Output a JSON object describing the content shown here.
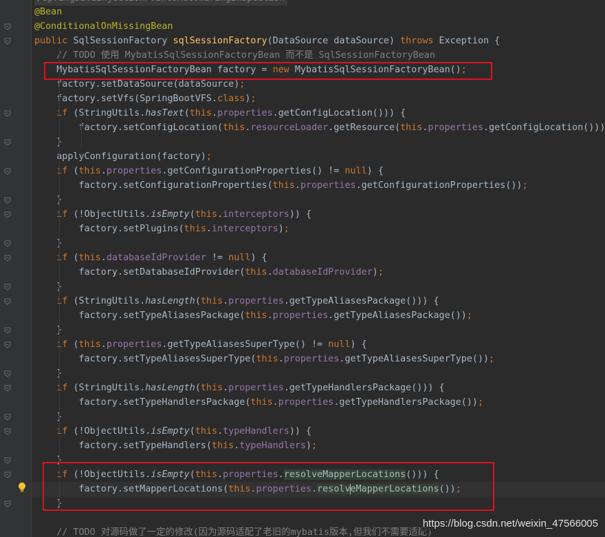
{
  "editor": {
    "top_partial": "/SpringJavaInjectionPointsAutowiringInspection",
    "lines": [
      [
        [
          "@Bean",
          "ann"
        ]
      ],
      [
        [
          "@ConditionalOnMissingBean",
          "ann"
        ]
      ],
      [
        [
          "public ",
          "kw"
        ],
        [
          "SqlSessionFactory ",
          "def"
        ],
        [
          "sqlSessionFactory",
          "fn"
        ],
        [
          "(DataSource dataSource) ",
          "def"
        ],
        [
          "throws ",
          "kw"
        ],
        [
          "Exception {",
          "def"
        ]
      ],
      [
        [
          "    // TODO 使用 MybatisSqlSessionFactoryBean 而不是 SqlSessionFactoryBean",
          "cm"
        ]
      ],
      [
        [
          "    MybatisSqlSessionFactoryBean factory = ",
          "def"
        ],
        [
          "new ",
          "kw"
        ],
        [
          "MybatisSqlSessionFactoryBean()",
          "def"
        ],
        [
          ";",
          "kw"
        ]
      ],
      [
        [
          "    factory.setDataSource(dataSource)",
          "def"
        ],
        [
          ";",
          "kw"
        ]
      ],
      [
        [
          "    factory.setVfs(SpringBootVFS.",
          "def"
        ],
        [
          "class",
          "kw"
        ],
        [
          ")",
          "def"
        ],
        [
          ";",
          "kw"
        ]
      ],
      [
        [
          "    ",
          "def"
        ],
        [
          "if ",
          "kw"
        ],
        [
          "(StringUtils.",
          "def"
        ],
        [
          "hasText",
          "it"
        ],
        [
          "(",
          "def"
        ],
        [
          "this",
          "kw"
        ],
        [
          ".",
          "def"
        ],
        [
          "properties",
          "fld"
        ],
        [
          ".getConfigLocation())) {",
          "def"
        ]
      ],
      [
        [
          "        factory.setConfigLocation(",
          "def"
        ],
        [
          "this",
          "kw"
        ],
        [
          ".",
          "def"
        ],
        [
          "resourceLoader",
          "fld"
        ],
        [
          ".getResource(",
          "def"
        ],
        [
          "this",
          "kw"
        ],
        [
          ".",
          "def"
        ],
        [
          "properties",
          "fld"
        ],
        [
          ".getConfigLocation()))",
          "def"
        ],
        [
          ";",
          "kw"
        ]
      ],
      [
        [
          "    }",
          "def"
        ]
      ],
      [
        [
          "    applyConfiguration(factory)",
          "def"
        ],
        [
          ";",
          "kw"
        ]
      ],
      [
        [
          "    ",
          "def"
        ],
        [
          "if ",
          "kw"
        ],
        [
          "(",
          "def"
        ],
        [
          "this",
          "kw"
        ],
        [
          ".",
          "def"
        ],
        [
          "properties",
          "fld"
        ],
        [
          ".getConfigurationProperties() != ",
          "def"
        ],
        [
          "null",
          "kw"
        ],
        [
          ") {",
          "def"
        ]
      ],
      [
        [
          "        factory.setConfigurationProperties(",
          "def"
        ],
        [
          "this",
          "kw"
        ],
        [
          ".",
          "def"
        ],
        [
          "properties",
          "fld"
        ],
        [
          ".getConfigurationProperties())",
          "def"
        ],
        [
          ";",
          "kw"
        ]
      ],
      [
        [
          "    }",
          "def"
        ]
      ],
      [
        [
          "    ",
          "def"
        ],
        [
          "if ",
          "kw"
        ],
        [
          "(!ObjectUtils.",
          "def"
        ],
        [
          "isEmpty",
          "it"
        ],
        [
          "(",
          "def"
        ],
        [
          "this",
          "kw"
        ],
        [
          ".",
          "def"
        ],
        [
          "interceptors",
          "fld"
        ],
        [
          ")) {",
          "def"
        ]
      ],
      [
        [
          "        factory.setPlugins(",
          "def"
        ],
        [
          "this",
          "kw"
        ],
        [
          ".",
          "def"
        ],
        [
          "interceptors",
          "fld"
        ],
        [
          ")",
          "def"
        ],
        [
          ";",
          "kw"
        ]
      ],
      [
        [
          "    }",
          "def"
        ]
      ],
      [
        [
          "    ",
          "def"
        ],
        [
          "if ",
          "kw"
        ],
        [
          "(",
          "def"
        ],
        [
          "this",
          "kw"
        ],
        [
          ".",
          "def"
        ],
        [
          "databaseIdProvider",
          "fld"
        ],
        [
          " != ",
          "def"
        ],
        [
          "null",
          "kw"
        ],
        [
          ") {",
          "def"
        ]
      ],
      [
        [
          "        factory.setDatabaseIdProvider(",
          "def"
        ],
        [
          "this",
          "kw"
        ],
        [
          ".",
          "def"
        ],
        [
          "databaseIdProvider",
          "fld"
        ],
        [
          ")",
          "def"
        ],
        [
          ";",
          "kw"
        ]
      ],
      [
        [
          "    }",
          "def"
        ]
      ],
      [
        [
          "    ",
          "def"
        ],
        [
          "if ",
          "kw"
        ],
        [
          "(StringUtils.",
          "def"
        ],
        [
          "hasLength",
          "it"
        ],
        [
          "(",
          "def"
        ],
        [
          "this",
          "kw"
        ],
        [
          ".",
          "def"
        ],
        [
          "properties",
          "fld"
        ],
        [
          ".getTypeAliasesPackage())) {",
          "def"
        ]
      ],
      [
        [
          "        factory.setTypeAliasesPackage(",
          "def"
        ],
        [
          "this",
          "kw"
        ],
        [
          ".",
          "def"
        ],
        [
          "properties",
          "fld"
        ],
        [
          ".getTypeAliasesPackage())",
          "def"
        ],
        [
          ";",
          "kw"
        ]
      ],
      [
        [
          "    }",
          "def"
        ]
      ],
      [
        [
          "    ",
          "def"
        ],
        [
          "if ",
          "kw"
        ],
        [
          "(",
          "def"
        ],
        [
          "this",
          "kw"
        ],
        [
          ".",
          "def"
        ],
        [
          "properties",
          "fld"
        ],
        [
          ".getTypeAliasesSuperType() != ",
          "def"
        ],
        [
          "null",
          "kw"
        ],
        [
          ") {",
          "def"
        ]
      ],
      [
        [
          "        factory.setTypeAliasesSuperType(",
          "def"
        ],
        [
          "this",
          "kw"
        ],
        [
          ".",
          "def"
        ],
        [
          "properties",
          "fld"
        ],
        [
          ".getTypeAliasesSuperType())",
          "def"
        ],
        [
          ";",
          "kw"
        ]
      ],
      [
        [
          "    }",
          "def"
        ]
      ],
      [
        [
          "    ",
          "def"
        ],
        [
          "if ",
          "kw"
        ],
        [
          "(StringUtils.",
          "def"
        ],
        [
          "hasLength",
          "it"
        ],
        [
          "(",
          "def"
        ],
        [
          "this",
          "kw"
        ],
        [
          ".",
          "def"
        ],
        [
          "properties",
          "fld"
        ],
        [
          ".getTypeHandlersPackage())) {",
          "def"
        ]
      ],
      [
        [
          "        factory.setTypeHandlersPackage(",
          "def"
        ],
        [
          "this",
          "kw"
        ],
        [
          ".",
          "def"
        ],
        [
          "properties",
          "fld"
        ],
        [
          ".getTypeHandlersPackage())",
          "def"
        ],
        [
          ";",
          "kw"
        ]
      ],
      [
        [
          "    }",
          "def"
        ]
      ],
      [
        [
          "    ",
          "def"
        ],
        [
          "if ",
          "kw"
        ],
        [
          "(!ObjectUtils.",
          "def"
        ],
        [
          "isEmpty",
          "it"
        ],
        [
          "(",
          "def"
        ],
        [
          "this",
          "kw"
        ],
        [
          ".",
          "def"
        ],
        [
          "typeHandlers",
          "fld"
        ],
        [
          ")) {",
          "def"
        ]
      ],
      [
        [
          "        factory.setTypeHandlers(",
          "def"
        ],
        [
          "this",
          "kw"
        ],
        [
          ".",
          "def"
        ],
        [
          "typeHandlers",
          "fld"
        ],
        [
          ")",
          "def"
        ],
        [
          ";",
          "kw"
        ]
      ],
      [
        [
          "    }",
          "def"
        ]
      ],
      [
        [
          "    ",
          "def"
        ],
        [
          "if ",
          "kw"
        ],
        [
          "(!ObjectUtils.",
          "def"
        ],
        [
          "isEmpty",
          "it"
        ],
        [
          "(",
          "def"
        ],
        [
          "this",
          "kw"
        ],
        [
          ".",
          "def"
        ],
        [
          "properties",
          "fld"
        ],
        [
          ".",
          "def"
        ],
        [
          "resolveMapperLocations",
          "hl"
        ],
        [
          "())) {",
          "def"
        ]
      ],
      [
        [
          "        factory.setMapperLocations(",
          "def"
        ],
        [
          "this",
          "kw"
        ],
        [
          ".",
          "def"
        ],
        [
          "properties",
          "fld"
        ],
        [
          ".",
          "def"
        ],
        [
          "resolv",
          "hl"
        ],
        [
          "|",
          "caret"
        ],
        [
          "eMapperLocations",
          "hl"
        ],
        [
          "())",
          "def"
        ],
        [
          ";",
          "kw"
        ]
      ],
      [
        [
          "    }",
          "def"
        ]
      ],
      [
        [
          "",
          "def"
        ]
      ],
      [
        [
          "    // TODO 对源码做了一定的修改(因为源码适配了老旧的mybatis版本,但我们不需要适配)",
          "cm"
        ]
      ]
    ]
  },
  "watermark": "https://blog.csdn.net/weixin_47566005",
  "colors": {
    "background": "#2b2b2b",
    "keyword": "#cc7832",
    "annotation": "#bbb529",
    "method_decl": "#ffc66d",
    "field": "#9876aa",
    "comment": "#808080",
    "highlight_box": "#e1111e"
  },
  "icons": [
    "fold-icon",
    "lightbulb-icon"
  ]
}
